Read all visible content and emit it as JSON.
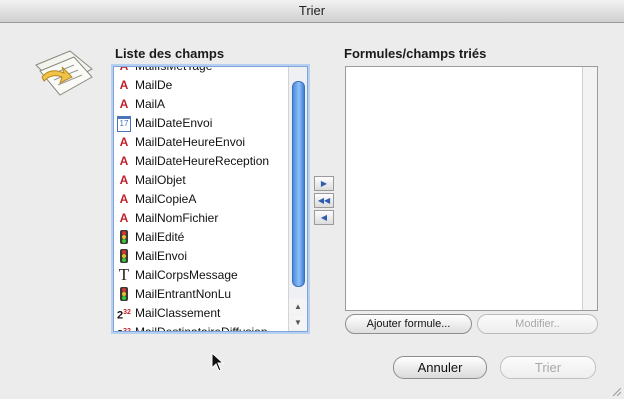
{
  "window": {
    "title": "Trier"
  },
  "fields_list": {
    "heading": "Liste des champs",
    "partial_top_label": "MailIsMetTage",
    "items": [
      {
        "label": "MailDe",
        "icon": "text-a-icon"
      },
      {
        "label": "MailA",
        "icon": "text-a-icon"
      },
      {
        "label": "MailDateEnvoi",
        "icon": "calendar-icon"
      },
      {
        "label": "MailDateHeureEnvoi",
        "icon": "text-a-icon"
      },
      {
        "label": "MailDateHeureReception",
        "icon": "text-a-icon"
      },
      {
        "label": "MailObjet",
        "icon": "text-a-icon"
      },
      {
        "label": "MailCopieA",
        "icon": "text-a-icon"
      },
      {
        "label": "MailNomFichier",
        "icon": "text-a-icon"
      },
      {
        "label": "MailEdité",
        "icon": "traffic-light-icon"
      },
      {
        "label": "MailEnvoi",
        "icon": "traffic-light-icon"
      },
      {
        "label": "MailCorpsMessage",
        "icon": "big-t-icon"
      },
      {
        "label": "MailEntrantNonLu",
        "icon": "traffic-light-icon"
      },
      {
        "label": "MailClassement",
        "icon": "number-icon"
      },
      {
        "label": "MailDestinataireDiffusion",
        "icon": "number-icon"
      }
    ]
  },
  "sorted_panel": {
    "heading": "Formules/champs triés"
  },
  "buttons": {
    "add_formula": "Ajouter formule...",
    "modify": "Modifier..",
    "cancel": "Annuler",
    "sort": "Trier"
  },
  "colors": {
    "accent": "#3f7fd8",
    "text_icon_red": "#c0202a"
  }
}
